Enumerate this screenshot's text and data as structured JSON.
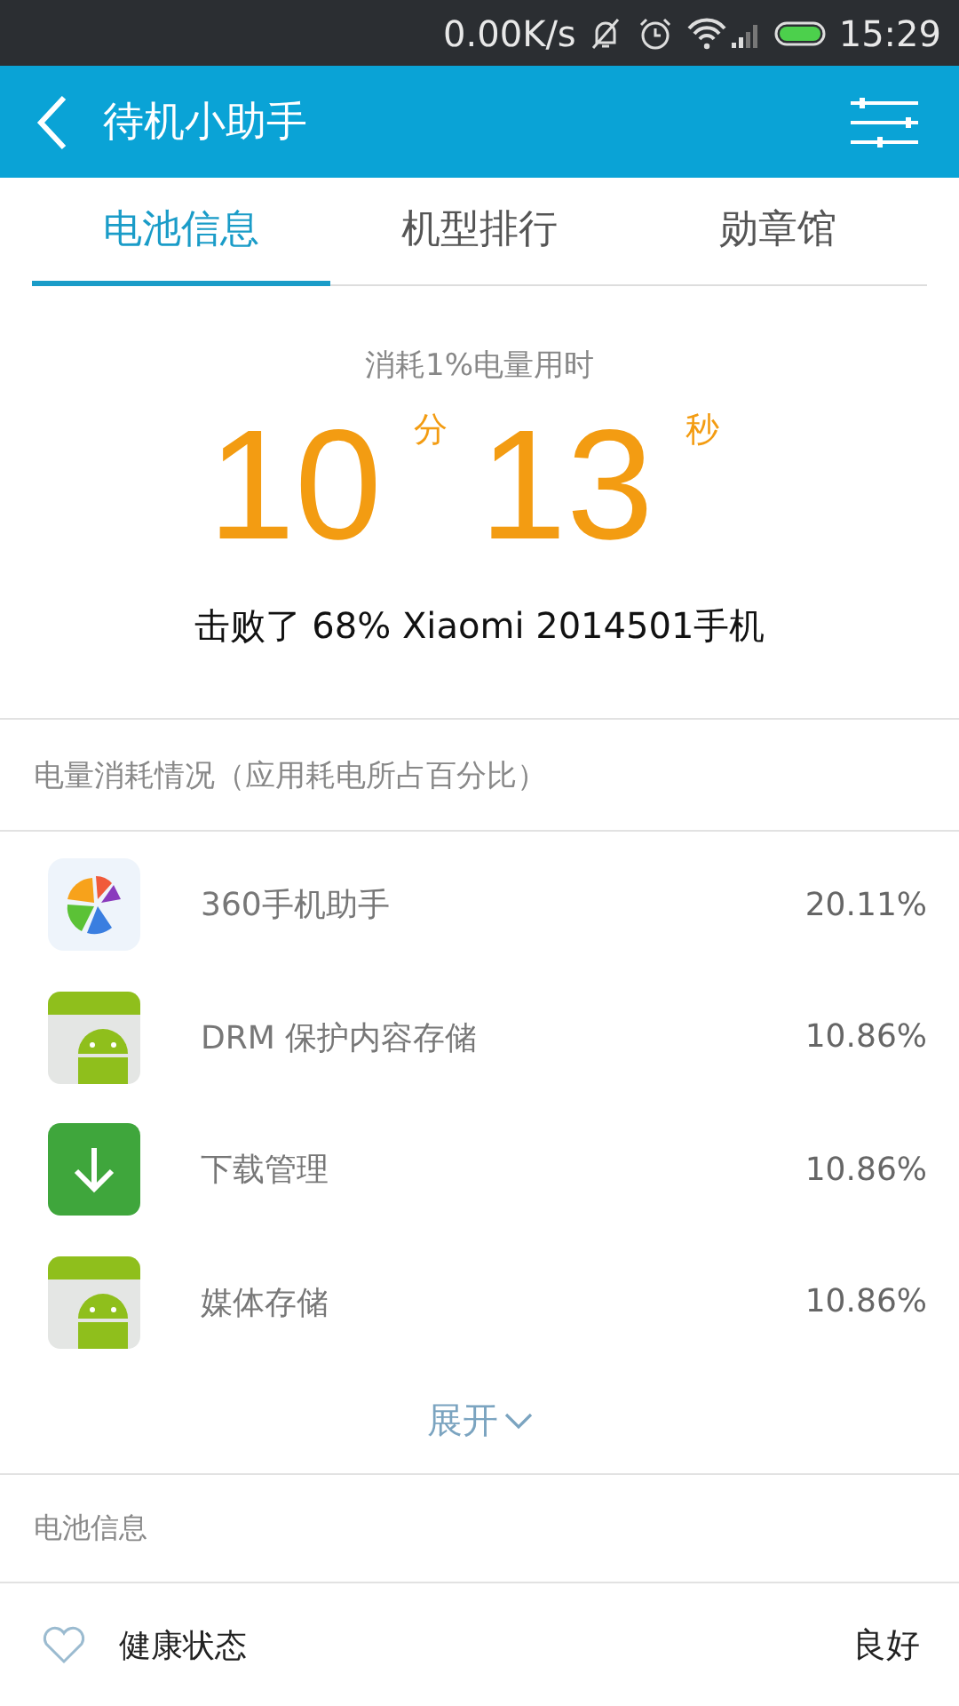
{
  "status_bar": {
    "speed": "0.00K/s",
    "time": "15:29"
  },
  "header": {
    "title": "待机小助手"
  },
  "tabs": [
    {
      "label": "电池信息",
      "selected": true
    },
    {
      "label": "机型排行",
      "selected": false
    },
    {
      "label": "勋章馆",
      "selected": false
    }
  ],
  "summary": {
    "caption": "消耗1%电量用时",
    "minutes": "10",
    "minutes_unit": "分",
    "seconds": "13",
    "seconds_unit": "秒",
    "ranking": "击败了 68% Xiaomi 2014501手机"
  },
  "usage": {
    "heading": "电量消耗情况（应用耗电所占百分比）",
    "apps": [
      {
        "kind": "colorful",
        "name": "360手机助手",
        "percent": "20.11%"
      },
      {
        "kind": "android",
        "name": "DRM 保护内容存储",
        "percent": "10.86%"
      },
      {
        "kind": "download",
        "name": "下载管理",
        "percent": "10.86%"
      },
      {
        "kind": "android",
        "name": "媒体存储",
        "percent": "10.86%"
      }
    ],
    "expand": "展开"
  },
  "battery": {
    "heading": "电池信息",
    "rows": [
      {
        "label": "健康状态",
        "value": "良好"
      }
    ]
  }
}
